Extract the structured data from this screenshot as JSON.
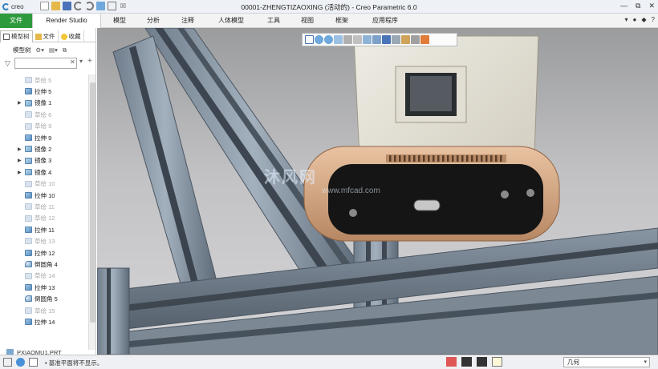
{
  "window": {
    "app_logo": "creo",
    "title": "00001-ZHENGTIZAOXING (活动的) - Creo Parametric 6.0",
    "controls": [
      "—",
      "⧉",
      "✕"
    ]
  },
  "ribbon": {
    "tabs": [
      "文件",
      "Render Studio",
      "模型",
      "分析",
      "注释",
      "人体模型",
      "工具",
      "视图",
      "框架",
      "应用程序"
    ]
  },
  "left_panel": {
    "tabs": [
      "模型树",
      "文件",
      "收藏"
    ],
    "tree_label": "模型树",
    "search_placeholder": "",
    "items": [
      {
        "label": "草绘 5",
        "type": "sketch",
        "suppressed": true,
        "expandable": false
      },
      {
        "label": "拉伸 5",
        "type": "extrude",
        "suppressed": false,
        "expandable": false
      },
      {
        "label": "镜像 1",
        "type": "mirror",
        "suppressed": false,
        "expandable": true
      },
      {
        "label": "草绘 6",
        "type": "sketch",
        "suppressed": true,
        "expandable": false
      },
      {
        "label": "草绘 9",
        "type": "sketch",
        "suppressed": true,
        "expandable": false
      },
      {
        "label": "拉伸 9",
        "type": "extrude",
        "suppressed": false,
        "expandable": false
      },
      {
        "label": "镜像 2",
        "type": "mirror",
        "suppressed": false,
        "expandable": true
      },
      {
        "label": "镜像 3",
        "type": "mirror",
        "suppressed": false,
        "expandable": true
      },
      {
        "label": "镜像 4",
        "type": "mirror",
        "suppressed": false,
        "expandable": true
      },
      {
        "label": "草绘 10",
        "type": "sketch",
        "suppressed": true,
        "expandable": false
      },
      {
        "label": "拉伸 10",
        "type": "extrude",
        "suppressed": false,
        "expandable": false
      },
      {
        "label": "草绘 11",
        "type": "sketch",
        "suppressed": true,
        "expandable": false
      },
      {
        "label": "草绘 12",
        "type": "sketch",
        "suppressed": true,
        "expandable": false
      },
      {
        "label": "拉伸 11",
        "type": "extrude",
        "suppressed": false,
        "expandable": false
      },
      {
        "label": "草绘 13",
        "type": "sketch",
        "suppressed": true,
        "expandable": false
      },
      {
        "label": "拉伸 12",
        "type": "extrude",
        "suppressed": false,
        "expandable": false
      },
      {
        "label": "倒圆角 4",
        "type": "round",
        "suppressed": false,
        "expandable": false
      },
      {
        "label": "草绘 14",
        "type": "sketch",
        "suppressed": true,
        "expandable": false
      },
      {
        "label": "拉伸 13",
        "type": "extrude",
        "suppressed": false,
        "expandable": false
      },
      {
        "label": "倒圆角 5",
        "type": "round",
        "suppressed": false,
        "expandable": false
      },
      {
        "label": "草绘 15",
        "type": "sketch",
        "suppressed": true,
        "expandable": false
      },
      {
        "label": "拉伸 14",
        "type": "extrude",
        "suppressed": false,
        "expandable": false
      }
    ],
    "part_row": "PXIAOMU1.PRT"
  },
  "viewport": {
    "watermark": "沐风网",
    "watermark_sub": "www.mfcad.com"
  },
  "status": {
    "message": "• 基准平面将不显示。",
    "filter_value": "几何"
  },
  "colors": {
    "file_tab": "#2e9a3e",
    "camera_body": "#c79a77",
    "camera_face": "#1a1a1a",
    "bracket": "#dedbd2"
  }
}
